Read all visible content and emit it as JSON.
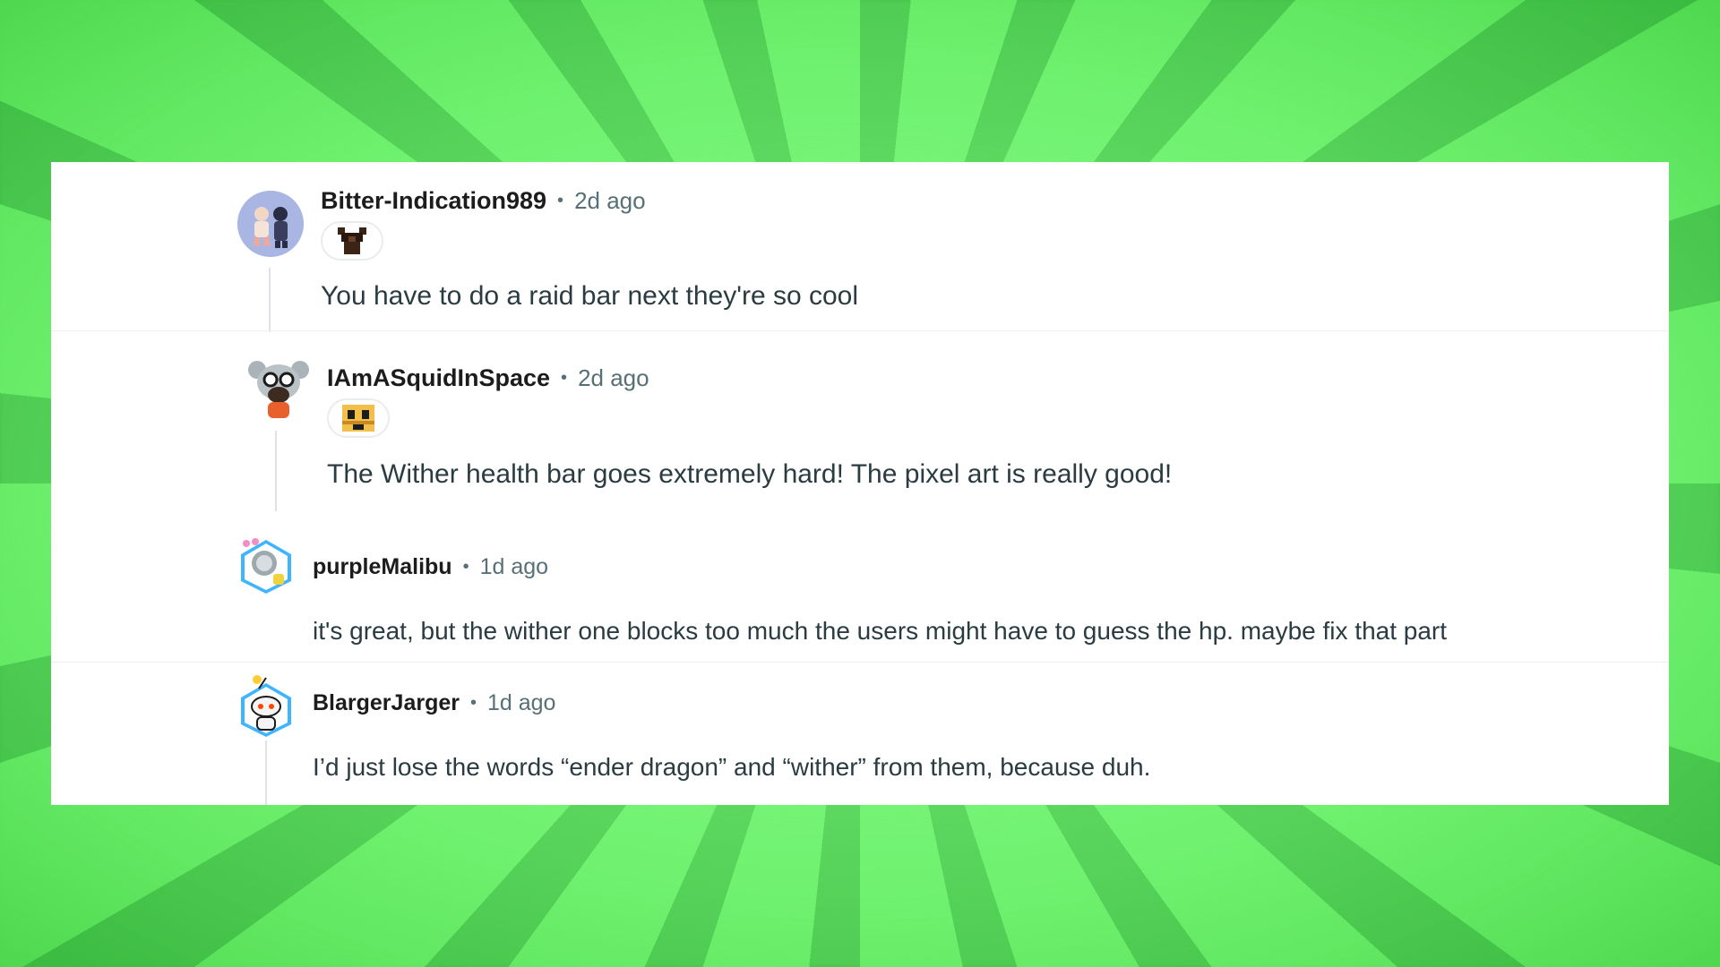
{
  "comments": [
    {
      "author": "Bitter-Indication989",
      "separator": "•",
      "time": "2d ago",
      "has_flair": true,
      "flair_icon": "dark-armor-flair-icon",
      "text": "You have to do a raid bar next they're so cool",
      "avatar_color": "#a9b6e3"
    },
    {
      "author": "IAmASquidInSpace",
      "separator": "•",
      "time": "2d ago",
      "has_flair": true,
      "flair_icon": "bee-flair-icon",
      "text": "The Wither health bar goes extremely hard! The pixel art is really good!",
      "avatar_color": "#ffffff"
    },
    {
      "author": "purpleMalibu",
      "separator": "•",
      "time": "1d ago",
      "has_flair": false,
      "text": "it's great, but the wither one blocks too much the users might have to guess the hp. maybe fix that part",
      "avatar_color": "#3fb4ff"
    },
    {
      "author": "BlargerJarger",
      "separator": "•",
      "time": "1d ago",
      "has_flair": false,
      "text": "I’d just lose the words “ender dragon” and “wither” from them, because duh.",
      "avatar_color": "#3fb4ff"
    }
  ],
  "colors": {
    "background_green": "#7af57a",
    "card": "#ffffff",
    "author": "#1c1c1c",
    "meta": "#576f76",
    "body": "#2a3c42"
  }
}
